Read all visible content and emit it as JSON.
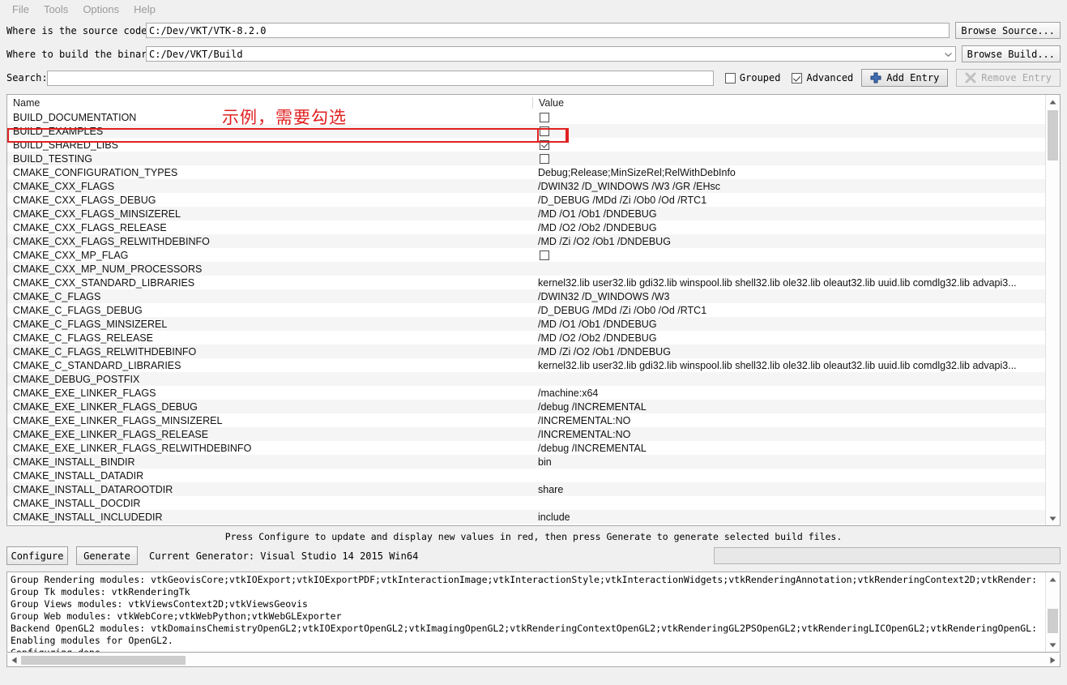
{
  "menubar": {
    "items": [
      {
        "label": "File",
        "name": "menu-file"
      },
      {
        "label": "Tools",
        "name": "menu-tools"
      },
      {
        "label": "Options",
        "name": "menu-options"
      },
      {
        "label": "Help",
        "name": "menu-help"
      }
    ]
  },
  "paths": {
    "source_label": "Where is the source code:",
    "source_value": "C:/Dev/VKT/VTK-8.2.0",
    "browse_source_label": "Browse Source...",
    "build_label": "Where to build the binaries:",
    "build_value": "C:/Dev/VKT/Build",
    "browse_build_label": "Browse Build..."
  },
  "search": {
    "label": "Search:",
    "value": "",
    "placeholder": "",
    "grouped_label": "Grouped",
    "grouped_checked": false,
    "advanced_label": "Advanced",
    "advanced_checked": true,
    "add_entry_label": "Add Entry",
    "remove_entry_label": "Remove Entry",
    "remove_entry_disabled": true
  },
  "annotation": {
    "text": "示例，需要勾选",
    "color": "#e02020",
    "highlight_row": "BUILD_EXAMPLES"
  },
  "table": {
    "columns": [
      "Name",
      "Value"
    ],
    "rows": [
      {
        "name": "BUILD_DOCUMENTATION",
        "type": "bool",
        "checked": false,
        "value": ""
      },
      {
        "name": "BUILD_EXAMPLES",
        "type": "bool",
        "checked": false,
        "value": "",
        "highlighted": true
      },
      {
        "name": "BUILD_SHARED_LIBS",
        "type": "bool",
        "checked": true,
        "value": ""
      },
      {
        "name": "BUILD_TESTING",
        "type": "bool",
        "checked": false,
        "value": ""
      },
      {
        "name": "CMAKE_CONFIGURATION_TYPES",
        "type": "text",
        "value": "Debug;Release;MinSizeRel;RelWithDebInfo"
      },
      {
        "name": "CMAKE_CXX_FLAGS",
        "type": "text",
        "value": " /DWIN32 /D_WINDOWS /W3 /GR /EHsc"
      },
      {
        "name": "CMAKE_CXX_FLAGS_DEBUG",
        "type": "text",
        "value": "/D_DEBUG /MDd /Zi /Ob0 /Od /RTC1"
      },
      {
        "name": "CMAKE_CXX_FLAGS_MINSIZEREL",
        "type": "text",
        "value": "/MD /O1 /Ob1 /DNDEBUG"
      },
      {
        "name": "CMAKE_CXX_FLAGS_RELEASE",
        "type": "text",
        "value": "/MD /O2 /Ob2 /DNDEBUG"
      },
      {
        "name": "CMAKE_CXX_FLAGS_RELWITHDEBINFO",
        "type": "text",
        "value": "/MD /Zi /O2 /Ob1 /DNDEBUG"
      },
      {
        "name": "CMAKE_CXX_MP_FLAG",
        "type": "bool",
        "checked": false,
        "value": ""
      },
      {
        "name": "CMAKE_CXX_MP_NUM_PROCESSORS",
        "type": "text",
        "value": ""
      },
      {
        "name": "CMAKE_CXX_STANDARD_LIBRARIES",
        "type": "text",
        "value": "kernel32.lib user32.lib gdi32.lib winspool.lib shell32.lib ole32.lib oleaut32.lib uuid.lib comdlg32.lib advapi3..."
      },
      {
        "name": "CMAKE_C_FLAGS",
        "type": "text",
        "value": " /DWIN32 /D_WINDOWS /W3"
      },
      {
        "name": "CMAKE_C_FLAGS_DEBUG",
        "type": "text",
        "value": "/D_DEBUG /MDd /Zi /Ob0 /Od /RTC1"
      },
      {
        "name": "CMAKE_C_FLAGS_MINSIZEREL",
        "type": "text",
        "value": "/MD /O1 /Ob1 /DNDEBUG"
      },
      {
        "name": "CMAKE_C_FLAGS_RELEASE",
        "type": "text",
        "value": "/MD /O2 /Ob2 /DNDEBUG"
      },
      {
        "name": "CMAKE_C_FLAGS_RELWITHDEBINFO",
        "type": "text",
        "value": "/MD /Zi /O2 /Ob1 /DNDEBUG"
      },
      {
        "name": "CMAKE_C_STANDARD_LIBRARIES",
        "type": "text",
        "value": "kernel32.lib user32.lib gdi32.lib winspool.lib shell32.lib ole32.lib oleaut32.lib uuid.lib comdlg32.lib advapi3..."
      },
      {
        "name": "CMAKE_DEBUG_POSTFIX",
        "type": "text",
        "value": ""
      },
      {
        "name": "CMAKE_EXE_LINKER_FLAGS",
        "type": "text",
        "value": " /machine:x64"
      },
      {
        "name": "CMAKE_EXE_LINKER_FLAGS_DEBUG",
        "type": "text",
        "value": "/debug /INCREMENTAL"
      },
      {
        "name": "CMAKE_EXE_LINKER_FLAGS_MINSIZEREL",
        "type": "text",
        "value": "/INCREMENTAL:NO"
      },
      {
        "name": "CMAKE_EXE_LINKER_FLAGS_RELEASE",
        "type": "text",
        "value": "/INCREMENTAL:NO"
      },
      {
        "name": "CMAKE_EXE_LINKER_FLAGS_RELWITHDEBINFO",
        "type": "text",
        "value": "/debug /INCREMENTAL"
      },
      {
        "name": "CMAKE_INSTALL_BINDIR",
        "type": "text",
        "value": "bin"
      },
      {
        "name": "CMAKE_INSTALL_DATADIR",
        "type": "text",
        "value": ""
      },
      {
        "name": "CMAKE_INSTALL_DATAROOTDIR",
        "type": "text",
        "value": "share"
      },
      {
        "name": "CMAKE_INSTALL_DOCDIR",
        "type": "text",
        "value": ""
      },
      {
        "name": "CMAKE_INSTALL_INCLUDEDIR",
        "type": "text",
        "value": "include"
      }
    ]
  },
  "footer": {
    "hint": "Press Configure to update and display new values in red, then press Generate to generate selected build files.",
    "configure_label": "Configure",
    "generate_label": "Generate",
    "generator_label": "Current Generator: Visual Studio 14 2015 Win64"
  },
  "log": {
    "lines": [
      "Group Rendering modules: vtkGeovisCore;vtkIOExport;vtkIOExportPDF;vtkInteractionImage;vtkInteractionStyle;vtkInteractionWidgets;vtkRenderingAnnotation;vtkRenderingContext2D;vtkRender:",
      "Group Tk modules: vtkRenderingTk",
      "Group Views modules: vtkViewsContext2D;vtkViewsGeovis",
      "Group Web modules: vtkWebCore;vtkWebPython;vtkWebGLExporter",
      "Backend OpenGL2 modules: vtkDomainsChemistryOpenGL2;vtkIOExportOpenGL2;vtkImagingOpenGL2;vtkRenderingContextOpenGL2;vtkRenderingGL2PSOpenGL2;vtkRenderingLICOpenGL2;vtkRenderingOpenGL:",
      "Enabling modules for OpenGL2.",
      "Configuring done"
    ]
  }
}
